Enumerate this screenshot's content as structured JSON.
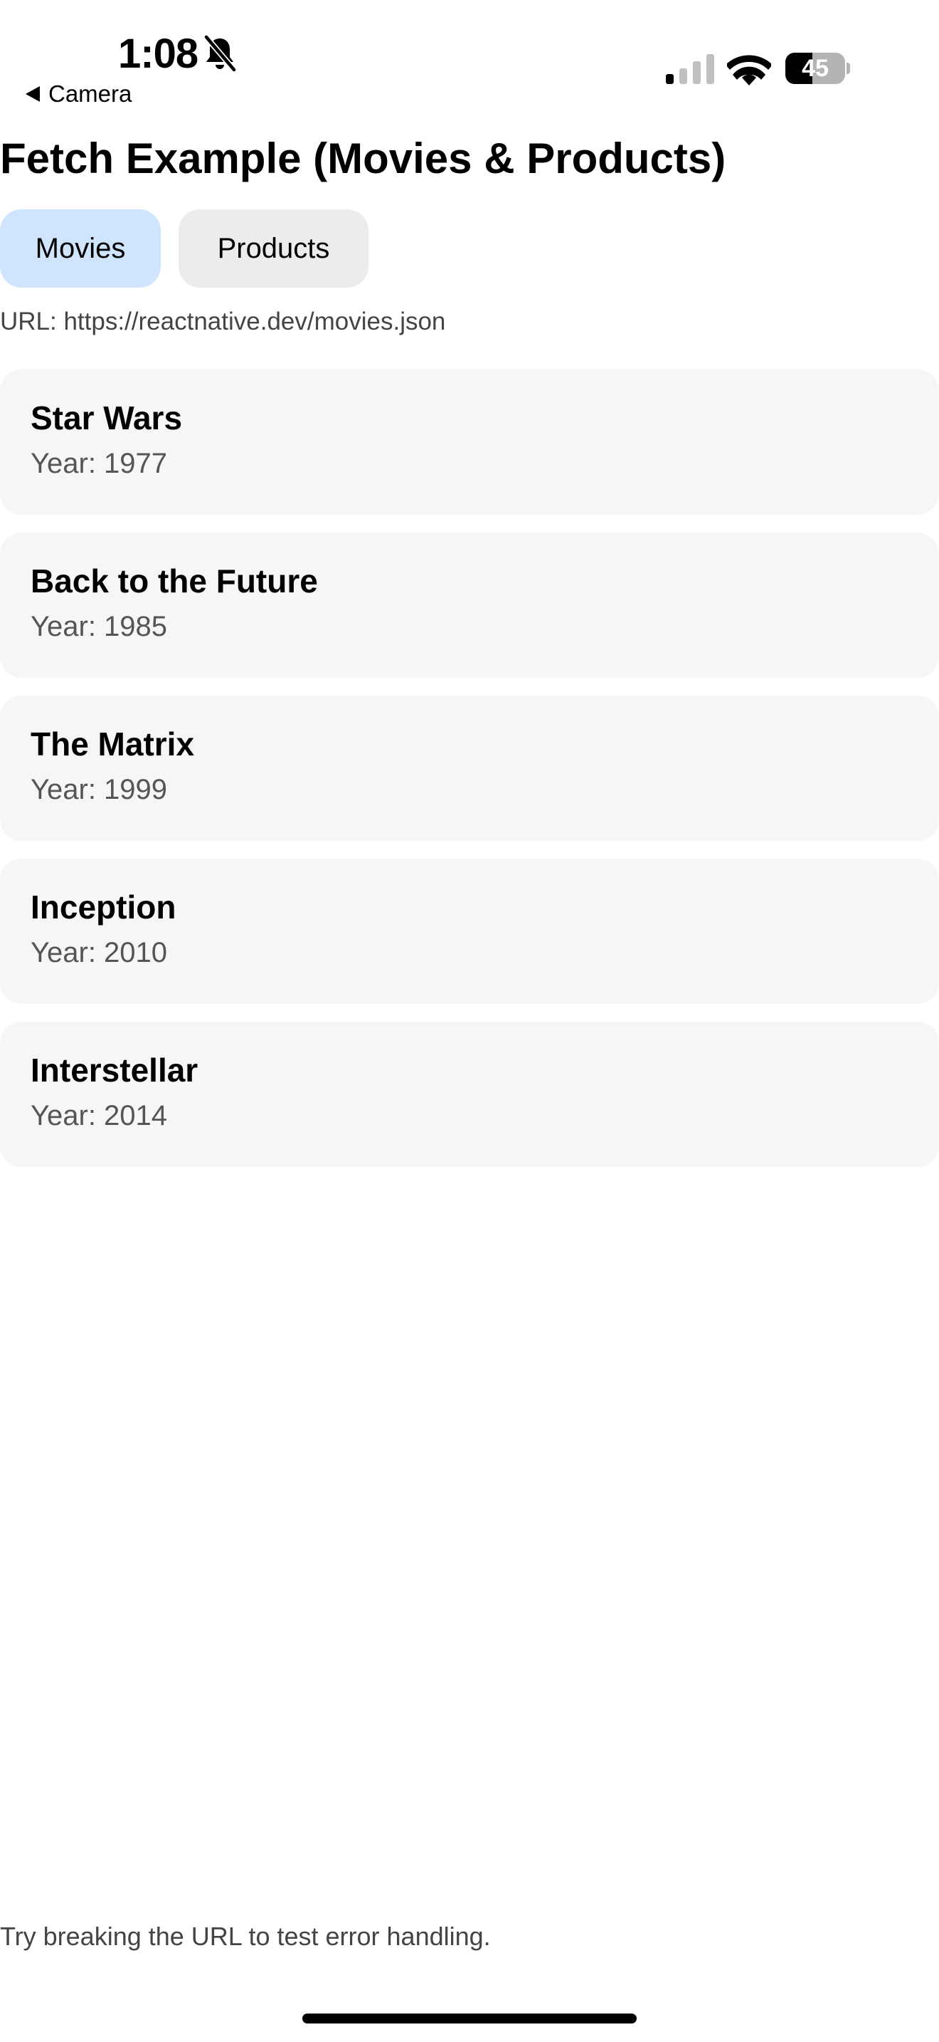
{
  "status_bar": {
    "time": "1:08",
    "back_label": "Camera",
    "battery_level": "45",
    "battery_fraction": 0.45,
    "signal_bars_active": 1,
    "signal_bars_total": 4
  },
  "header": {
    "title": "Fetch Example (Movies & Products)"
  },
  "tabs": [
    {
      "label": "Movies",
      "selected": true
    },
    {
      "label": "Products",
      "selected": false
    }
  ],
  "url_text": "URL: https://reactnative.dev/movies.json",
  "movies": [
    {
      "title": "Star Wars",
      "year": "Year: 1977"
    },
    {
      "title": "Back to the Future",
      "year": "Year: 1985"
    },
    {
      "title": "The Matrix",
      "year": "Year: 1999"
    },
    {
      "title": "Inception",
      "year": "Year: 2010"
    },
    {
      "title": "Interstellar",
      "year": "Year: 2014"
    }
  ],
  "footer": {
    "hint": "Try breaking the URL to test error handling."
  },
  "colors": {
    "selected_tab": "#cfe4fd",
    "unselected_tab": "#ececec",
    "card_background": "#f6f6f6"
  }
}
